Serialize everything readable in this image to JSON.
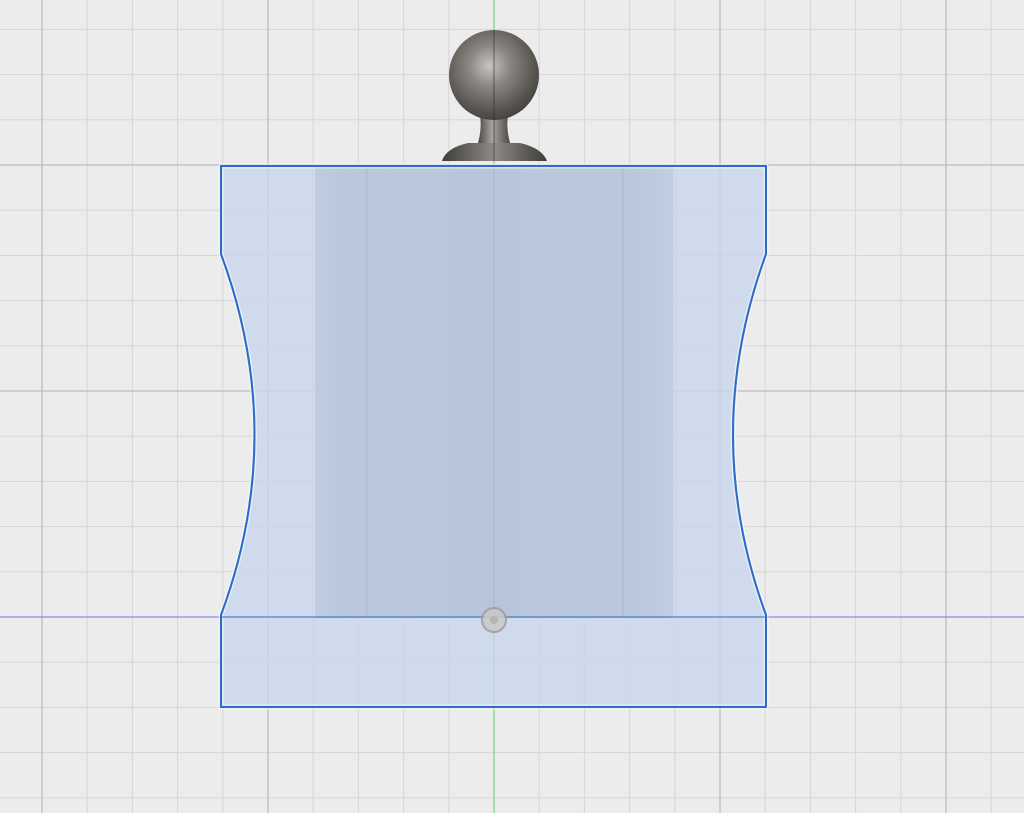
{
  "viewport": {
    "background_color": "#ececec",
    "grid_minor_color": "#d6d6d6",
    "grid_major_color": "#bdbdbd",
    "x_axis_color": "#7b7bf0",
    "y_axis_color": "#7fe07f"
  },
  "model": {
    "selected_profile": {
      "fill_color": "#c8d6ec",
      "outline_color": "#2f6cc9"
    },
    "cylinder_body": {
      "base_color": "#7c8896",
      "edge_color": "#3b3f45"
    },
    "finial_knob": {
      "metal_color": "#6f6b66"
    },
    "origin_point": {
      "icon": "origin-point-icon"
    }
  }
}
